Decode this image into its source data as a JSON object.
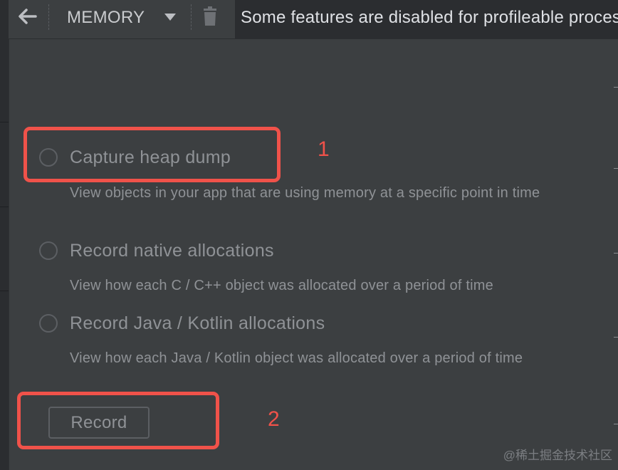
{
  "toolbar": {
    "mode_label": "MEMORY",
    "banner_text": "Some features are disabled for profileable processes"
  },
  "icons": {
    "back": "arrow-left-icon",
    "mode_dropdown": "triangle-down-icon",
    "delete": "trash-icon"
  },
  "options": [
    {
      "label": "Capture heap dump",
      "description": "View objects in your app that are using memory at a specific point in time"
    },
    {
      "label": "Record native allocations",
      "description": "View how each C / C++ object was allocated over a period of time"
    },
    {
      "label": "Record Java / Kotlin allocations",
      "description": "View how each Java / Kotlin object was allocated over a period of time"
    }
  ],
  "record_button": {
    "label": "Record"
  },
  "annotations": [
    {
      "number": "1"
    },
    {
      "number": "2"
    }
  ],
  "watermark": "@稀土掘金技术社区",
  "colors": {
    "background": "#3c3f41",
    "banner_background": "#2b2d30",
    "annotation_red": "#f0524a",
    "disabled_text": "#8f9296"
  }
}
